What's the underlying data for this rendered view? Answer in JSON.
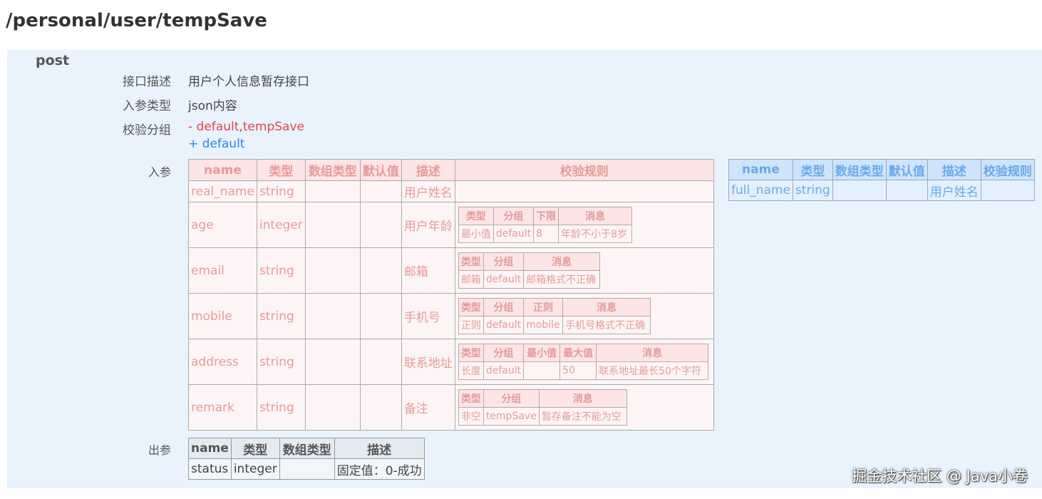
{
  "api": {
    "path": "/personal/user/tempSave",
    "method": "post",
    "fields": {
      "desc_label": "接口描述",
      "desc_value": "用户个人信息暂存接口",
      "type_label": "入参类型",
      "type_value": "json内容",
      "group_label": "校验分组",
      "group_minus": "- default,tempSave",
      "group_plus": "+ default"
    }
  },
  "input": {
    "label": "入参",
    "headers": [
      "name",
      "类型",
      "数组类型",
      "默认值",
      "描述",
      "校验规则"
    ],
    "rows": [
      {
        "name": "real_name",
        "type": "string",
        "array_type": "",
        "default": "",
        "desc": "用户姓名"
      },
      {
        "name": "age",
        "type": "integer",
        "array_type": "",
        "default": "",
        "desc": "用户年龄",
        "rule_headers": [
          "类型",
          "分组",
          "下限",
          "消息"
        ],
        "rule_values": [
          "最小值",
          "default",
          "8",
          "年龄不小于8岁"
        ]
      },
      {
        "name": "email",
        "type": "string",
        "array_type": "",
        "default": "",
        "desc": "邮箱",
        "rule_headers": [
          "类型",
          "分组",
          "消息"
        ],
        "rule_values": [
          "邮箱",
          "default",
          "邮箱格式不正确"
        ]
      },
      {
        "name": "mobile",
        "type": "string",
        "array_type": "",
        "default": "",
        "desc": "手机号",
        "rule_headers": [
          "类型",
          "分组",
          "正则",
          "消息"
        ],
        "rule_values": [
          "正则",
          "default",
          "mobile",
          "手机号格式不正确"
        ]
      },
      {
        "name": "address",
        "type": "string",
        "array_type": "",
        "default": "",
        "desc": "联系地址",
        "rule_headers": [
          "类型",
          "分组",
          "最小值",
          "最大值",
          "消息"
        ],
        "rule_values": [
          "长度",
          "default",
          "",
          "50",
          "联系地址最长50个字符"
        ]
      },
      {
        "name": "remark",
        "type": "string",
        "array_type": "",
        "default": "",
        "desc": "备注",
        "rule_headers": [
          "类型",
          "分组",
          "消息"
        ],
        "rule_values": [
          "非空",
          "tempSave",
          "暂存备注不能为空"
        ]
      }
    ]
  },
  "input_added": {
    "headers": [
      "name",
      "类型",
      "数组类型",
      "默认值",
      "描述",
      "校验规则"
    ],
    "rows": [
      {
        "name": "full_name",
        "type": "string",
        "array_type": "",
        "default": "",
        "desc": "用户姓名",
        "rules": ""
      }
    ]
  },
  "output": {
    "label": "出参",
    "headers": [
      "name",
      "类型",
      "数组类型",
      "描述"
    ],
    "rows": [
      {
        "name": "status",
        "type": "integer",
        "array_type": "",
        "desc": "固定值：0-成功"
      }
    ]
  },
  "watermark": "掘金技术社区 @ Java小卷",
  "colors": {
    "panel_bg": "#e8f3fe",
    "removed": "#e2464e",
    "added": "#2a86e6"
  }
}
